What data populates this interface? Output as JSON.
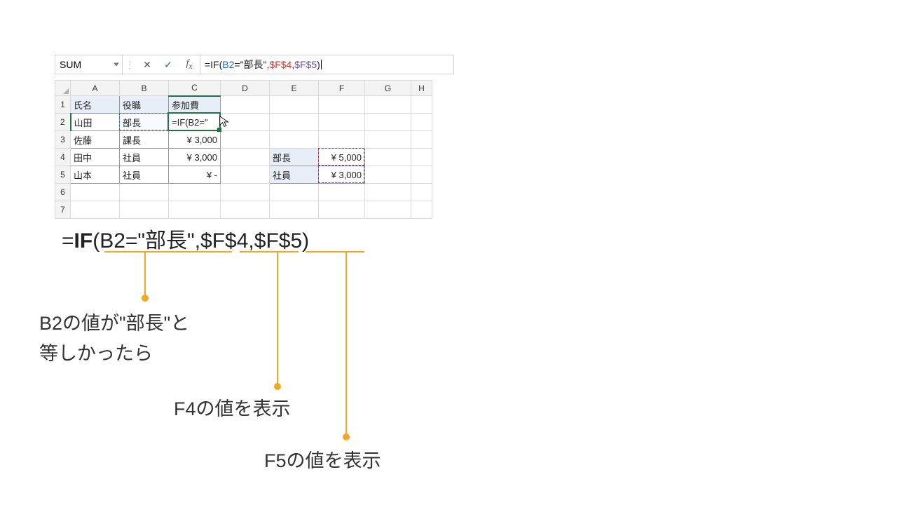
{
  "namebox": {
    "value": "SUM"
  },
  "formula_bar": {
    "prefix": "=IF(",
    "arg1": "B2",
    "mid1": "=\"部長\",",
    "arg2": "$F$4",
    "mid2": ",",
    "arg3": "$F$5",
    "suffix": ")"
  },
  "columns": [
    "A",
    "B",
    "C",
    "D",
    "E",
    "F",
    "G",
    "H"
  ],
  "row_numbers": [
    "1",
    "2",
    "3",
    "4",
    "5",
    "6",
    "7"
  ],
  "cells": {
    "A1": "氏名",
    "B1": "役職",
    "C1": "参加費",
    "A2": "山田",
    "B2": "部長",
    "C2": "=IF(B2=\"",
    "A3": "佐藤",
    "B3": "課長",
    "C3": "¥   3,000",
    "A4": "田中",
    "B4": "社員",
    "C4": "¥   3,000",
    "A5": "山本",
    "B5": "社員",
    "C5": "¥         -",
    "E4": "部長",
    "F4": "¥   5,000",
    "E5": "社員",
    "F5": "¥   3,000"
  },
  "annotation": {
    "formula_display": {
      "eq": "=",
      "fn": "IF",
      "open": "(B2=\"部長\",$F$4,$F$5)"
    },
    "note1_line1": "B2の値が\"部長\"と",
    "note1_line2": "等しかったら",
    "note2": "F4の値を表示",
    "note3": "F5の値を表示"
  }
}
